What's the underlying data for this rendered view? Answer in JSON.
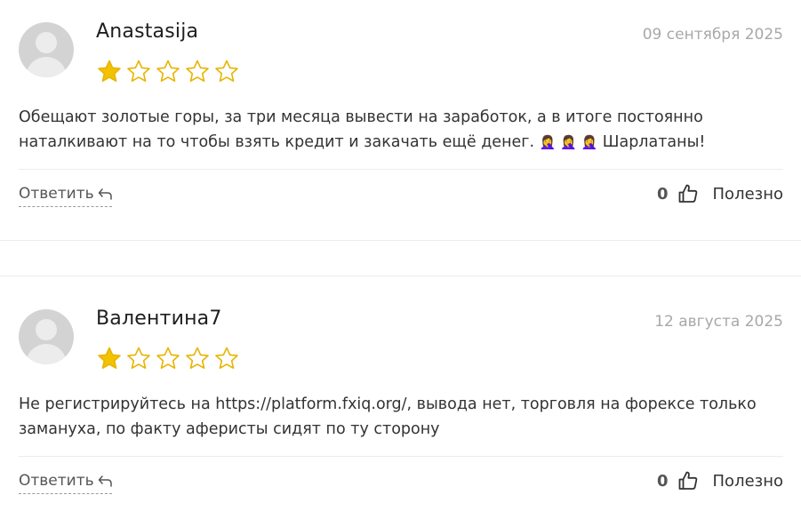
{
  "colors": {
    "star_filled": "#f2c200",
    "star_outline": "#e8b400",
    "avatar_bg": "#d3d3d3",
    "date_text": "#a8a8a8"
  },
  "reviews": [
    {
      "author": "Anastasija",
      "date": "09 сентября 2025",
      "rating": 1,
      "max_rating": 5,
      "text_line_1": "Обещают золотые горы, за три месяца вывести на заработок, а в итоге постоянно",
      "text_line_2": "наталкивают на то чтобы взять кредит и закачать ещё денег.",
      "emoji": "🤦‍♀️ 🤦‍♀️ 🤦‍♀️",
      "text_tail": " Шарлатаны!",
      "reply_label": "Ответить",
      "helpful_count": "0",
      "helpful_label": "Полезно"
    },
    {
      "author": "Валентина7",
      "date": "12 августа 2025",
      "rating": 1,
      "max_rating": 5,
      "text_line_1": "Не регистрируйтесь на https://platform.fxiq.org/, вывода нет, торговля на форексе только",
      "text_line_2": "замануха, по факту аферисты сидят по ту сторону",
      "reply_label": "Ответить",
      "helpful_count": "0",
      "helpful_label": "Полезно"
    }
  ]
}
